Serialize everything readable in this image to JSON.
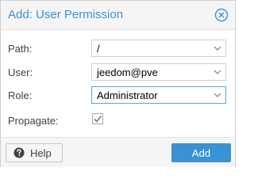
{
  "dialog": {
    "title": "Add: User Permission"
  },
  "form": {
    "path": {
      "label": "Path:",
      "value": "/"
    },
    "user": {
      "label": "User:",
      "value": "jeedom@pve"
    },
    "role": {
      "label": "Role:",
      "value": "Administrator"
    },
    "propagate": {
      "label": "Propagate:",
      "checked": true
    }
  },
  "footer": {
    "help_label": "Help",
    "add_label": "Add"
  },
  "colors": {
    "accent": "#3892d4",
    "focus_border": "#5fa2dd"
  },
  "icons": {
    "close": "close-circle-icon",
    "dropdown": "chevron-down-icon",
    "check": "checkmark-icon",
    "help": "question-circle-icon"
  }
}
